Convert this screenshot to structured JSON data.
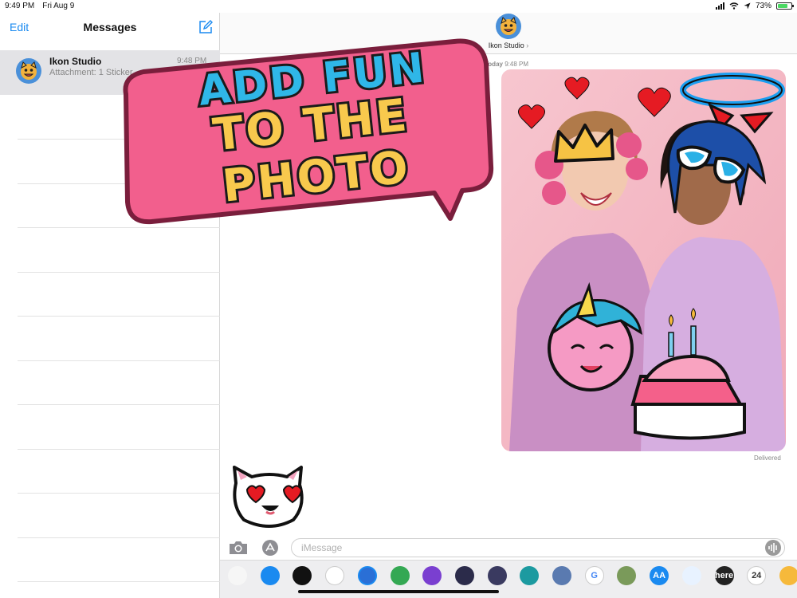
{
  "status_bar": {
    "time": "9:49 PM",
    "date": "Fri Aug 9",
    "battery": "73%",
    "battery_level": 0.73
  },
  "sidebar": {
    "edit_label": "Edit",
    "title": "Messages",
    "conversation": {
      "name": "Ikon Studio",
      "preview": "Attachment: 1 Sticker",
      "time": "9:48 PM"
    }
  },
  "conversation": {
    "contact_name": "Ikon Studio",
    "chevron": "›",
    "day_label": "Today",
    "time_label": "9:48 PM",
    "delivered": "Delivered"
  },
  "promo": {
    "line1": "ADD FUN",
    "line2": "TO THE PHOTO"
  },
  "composer": {
    "placeholder": "iMessage"
  },
  "drawer_apps": [
    {
      "name": "photos-app-icon",
      "label": ""
    },
    {
      "name": "app-store-icon",
      "label": ""
    },
    {
      "name": "digital-touch-icon",
      "label": ""
    },
    {
      "name": "music-icon",
      "label": ""
    },
    {
      "name": "ikon-sticker-app-icon",
      "label": ""
    },
    {
      "name": "maps-icon",
      "label": ""
    },
    {
      "name": "purple-app-icon",
      "label": ""
    },
    {
      "name": "game-app-icon",
      "label": ""
    },
    {
      "name": "character-app-icon",
      "label": ""
    },
    {
      "name": "girl-character-icon",
      "label": ""
    },
    {
      "name": "portrait-app-icon",
      "label": ""
    },
    {
      "name": "google-icon",
      "label": "G"
    },
    {
      "name": "chat-app-icon",
      "label": ""
    },
    {
      "name": "font-app-icon",
      "label": "AA"
    },
    {
      "name": "cartoon-app-icon",
      "label": ""
    },
    {
      "name": "here-app-icon",
      "label": "here"
    },
    {
      "name": "calendar-24-icon",
      "label": "24"
    },
    {
      "name": "dog-app-icon",
      "label": ""
    }
  ],
  "colors": {
    "accent": "#1a8af0",
    "promo_bubble": "#f25f8d",
    "promo_line1": "#2fb7e8",
    "promo_line2": "#f8c94d"
  }
}
